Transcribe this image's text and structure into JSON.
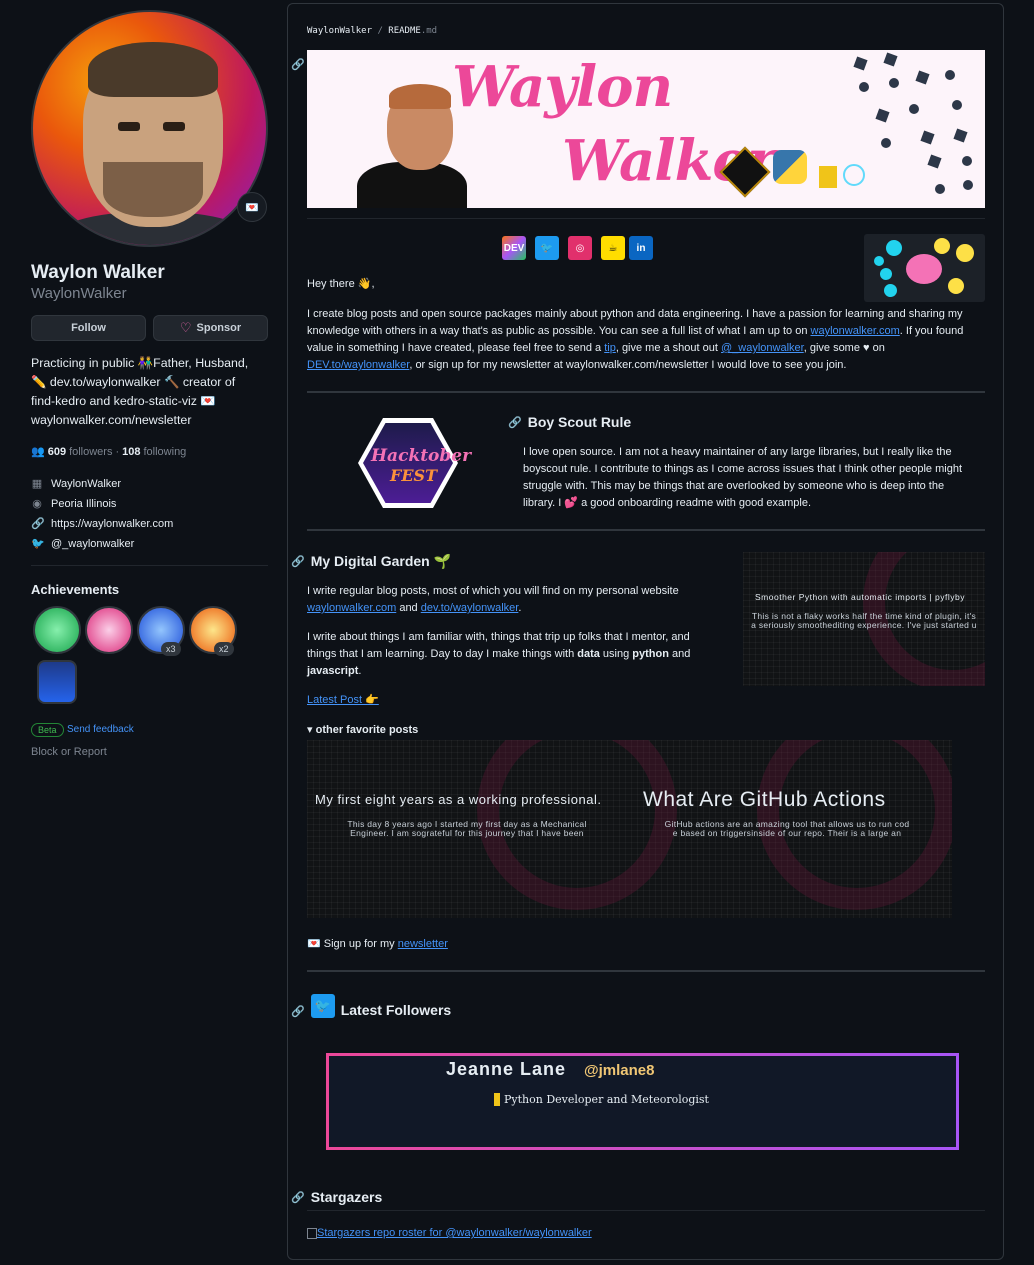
{
  "profile": {
    "name": "Waylon Walker",
    "login": "WaylonWalker",
    "status_emoji": "💌",
    "follow_label": "Follow",
    "sponsor_label": "Sponsor",
    "bio_lines": [
      "Practicing in public 👫Father, Husband,",
      "✏️ dev.to/waylonwalker 🔨 creator of",
      "find-kedro and kedro-static-viz 💌",
      "waylonwalker.com/newsletter"
    ],
    "followers_count": "609",
    "followers_label": "followers",
    "separator": "·",
    "following_count": "108",
    "following_label": "following",
    "company": "WaylonWalker",
    "location": "Peoria Illinois",
    "website": "https://waylonwalker.com",
    "twitter": "@_waylonwalker",
    "achievements_title": "Achievements",
    "achievement_badges": [
      {
        "name": "pair-extraordinaire",
        "color": "#4ade80",
        "count": ""
      },
      {
        "name": "yolo",
        "color": "#f472b6",
        "count": ""
      },
      {
        "name": "pull-shark",
        "color": "#3b82f6",
        "count": "x3"
      },
      {
        "name": "quickdraw",
        "color": "#fcd34d",
        "count": "x2"
      },
      {
        "name": "arctic-code-vault",
        "color": "#1e40af",
        "count": ""
      }
    ],
    "beta_label": "Beta",
    "feedback_label": "Send feedback",
    "block_label": "Block or Report"
  },
  "readme": {
    "path_owner": "WaylonWalker",
    "path_sep": " / ",
    "path_file": "README",
    "path_ext": ".md",
    "banner": {
      "first": "Waylon",
      "last": "Walker"
    },
    "social_icons": [
      {
        "name": "dev-icon",
        "label": "DEV",
        "color": "#f97316"
      },
      {
        "name": "twitter-icon",
        "label": "🐦",
        "color": "#1d9bf0"
      },
      {
        "name": "instagram-icon",
        "label": "◎",
        "color": "#e1306c"
      },
      {
        "name": "buymeacoffee-icon",
        "label": "☕",
        "color": "#ffdd00"
      },
      {
        "name": "linkedin-icon",
        "label": "in",
        "color": "#0a66c2"
      }
    ],
    "greeting": "Hey there 👋,",
    "intro": {
      "t1": "I create blog posts and open source packages mainly about python and data engineering. I have a passion for learning and sharing my",
      "t2": "knowledge with others in a way that's as public as possible. You can see a full list of what I am up to on ",
      "l1": "waylonwalker.com",
      "t3": ". If you found",
      "t4": "value in something I have created, please feel free to send a ",
      "l2": "tip",
      "t5": ", give me a shout out ",
      "l3": "@_waylonwalker",
      "t6": ", give some ♥ on",
      "l4": "DEV.to/waylonwalker",
      "t7": ", or sign up for my newsletter at waylonwalker.com/newsletter I would love to see you join."
    },
    "boy_scout": {
      "title": "Boy Scout Rule",
      "hacktober_1": "Hacktober",
      "hacktober_2": "FEST",
      "lines": [
        "I love open source. I am not a heavy maintainer of any large libraries, but I really like the",
        "boyscout rule. I contribute to things as I come across issues that I think other people might",
        "struggle with. This may be things that are overlooked by someone who is deep into the",
        "library. I 💕 a good onboarding readme with good example."
      ]
    },
    "garden": {
      "title": "My Digital Garden 🌱",
      "p1": "I write regular blog posts, most of which you will find on my personal website",
      "p1_link1": "waylonwalker.com",
      "p1_and": " and ",
      "p1_link2": "dev.to/waylonwalker",
      "p1_end": ".",
      "p2_l1": "I write about things I am familiar with, things that trip up folks that I mentor, and",
      "p2_l2a": "things that I am learning. Day to day I make things with ",
      "p2_data": "data",
      "p2_using": " using ",
      "p2_python": "python",
      "p2_and": " and",
      "p2_js": "javascript",
      "p2_end": ".",
      "latest_post": "Latest Post 👉",
      "latest_card_title": "Smoother Python with automatic imports | pyflyby",
      "latest_card_sub1": "This is not a flaky works half the time kind of plugin, it's",
      "latest_card_sub2": "a seriously smoothediting experience.  I've just started u",
      "details_summary": "other favorite posts",
      "card1_title": "My first eight years as a working professional.",
      "card1_sub1": "This day 8 years ago I started my first day as a Mechanical",
      "card1_sub2": "Engineer. I am sograteful for this journey that I have been",
      "card2_title": "What Are GitHub Actions",
      "card2_sub1": "GitHub actions are an amazing tool that allows us to run cod",
      "card2_sub2": "e based on triggersinside of our repo.  Their is a large an",
      "newsletter_pre": "💌 Sign up for my ",
      "newsletter_link": "newsletter"
    },
    "followers": {
      "title": "Latest Followers",
      "name": "Jeanne Lane",
      "handle": "@jmlane8",
      "bio": "Python Developer and Meteorologist"
    },
    "stargazers": {
      "title": "Stargazers",
      "alt": "Stargazers repo roster for @waylonwalker/waylonwalker"
    }
  }
}
